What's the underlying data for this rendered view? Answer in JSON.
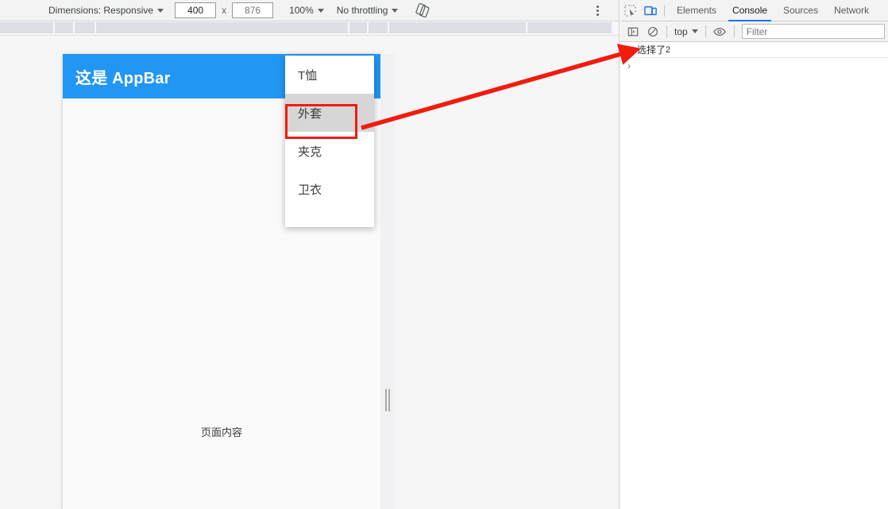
{
  "device_toolbar": {
    "dimensions_label": "Dimensions: Responsive",
    "width_value": "400",
    "height_placeholder": "876",
    "multiply_symbol": "x",
    "zoom_label": "100%",
    "throttling_label": "No throttling",
    "rotate_icon": "rotate-icon",
    "more_options_icon": "kebab-menu-icon"
  },
  "emulated_page": {
    "appbar_title": "这是 AppBar",
    "appbar_color": "#2196f3",
    "body_text": "页面内容",
    "body_background": "#fafafa",
    "dropdown": {
      "items": [
        {
          "label": "T恤",
          "selected": false
        },
        {
          "label": "外套",
          "selected": true
        },
        {
          "label": "夹克",
          "selected": false
        },
        {
          "label": "卫衣",
          "selected": false
        }
      ],
      "selected_highlight_color": "#d6d6d6",
      "annotation_box_color": "#f01c0e"
    }
  },
  "annotation": {
    "arrow_color": "#f01c0e",
    "arrow_name": "red-pointer-arrow"
  },
  "devtools": {
    "inspect_icon": "inspect-element-icon",
    "device_toolbar_icon": "device-toolbar-icon",
    "tabs": [
      {
        "label": "Elements",
        "active": false
      },
      {
        "label": "Console",
        "active": true
      },
      {
        "label": "Sources",
        "active": false
      },
      {
        "label": "Network",
        "active": false
      }
    ],
    "subbar": {
      "sidebar_icon": "console-sidebar-icon",
      "clear_icon": "clear-console-icon",
      "context_label": "top",
      "eye_icon": "live-expression-eye-icon",
      "filter_placeholder": "Filter"
    },
    "console": {
      "messages": [
        {
          "text": "选择了",
          "number": "2",
          "marker": "expand-arrow-icon"
        }
      ],
      "prompt_symbol": "›"
    }
  }
}
